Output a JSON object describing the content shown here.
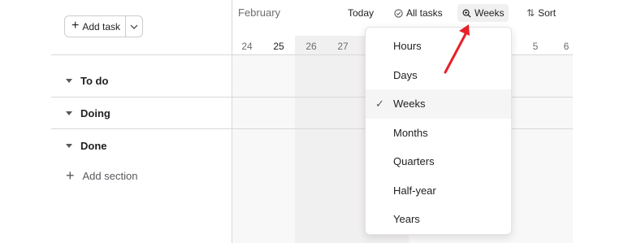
{
  "toolbar": {
    "add_task_label": "Add task",
    "today_label": "Today",
    "all_tasks_label": "All tasks",
    "zoom_label": "Weeks",
    "sort_label": "Sort"
  },
  "timeline": {
    "month": "February",
    "days_left": [
      "24",
      "25",
      "26",
      "27"
    ],
    "days_right": [
      "5",
      "6"
    ],
    "today_day": "25"
  },
  "sections": [
    {
      "label": "To do"
    },
    {
      "label": "Doing"
    },
    {
      "label": "Done"
    }
  ],
  "add_section_label": "Add section",
  "zoom_menu": {
    "options": [
      "Hours",
      "Days",
      "Weeks",
      "Months",
      "Quarters",
      "Half-year",
      "Years"
    ],
    "selected": "Weeks"
  },
  "colors": {
    "annotation_arrow": "#e8202a",
    "divider": "#d9d7d7",
    "active_bg": "#f1f0f0"
  },
  "icons": {
    "add": "plus-icon",
    "dropdown": "chevron-down-icon",
    "all_tasks": "check-circle-icon",
    "zoom": "zoom-icon",
    "sort": "sort-arrows-icon",
    "collapse": "triangle-down-icon",
    "selected": "checkmark-icon"
  }
}
